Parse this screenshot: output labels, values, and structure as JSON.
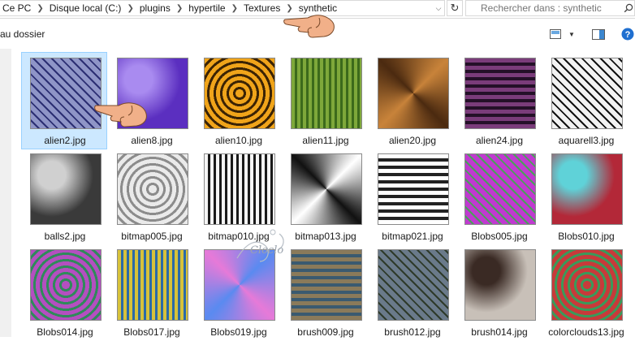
{
  "breadcrumb": {
    "items": [
      "Ce PC",
      "Disque local (C:)",
      "plugins",
      "hypertile",
      "Textures",
      "synthetic"
    ]
  },
  "search": {
    "placeholder": "Rechercher dans : synthetic"
  },
  "toolbar": {
    "up_label": "au dossier"
  },
  "files": [
    {
      "name": "alien2.jpg",
      "selected": true,
      "colors": [
        "#8f95c7",
        "#2c2f73"
      ]
    },
    {
      "name": "alien8.jpg",
      "colors": [
        "#a98bf0",
        "#5b2fc0"
      ]
    },
    {
      "name": "alien10.jpg",
      "colors": [
        "#f0a41a",
        "#3b2304"
      ]
    },
    {
      "name": "alien11.jpg",
      "colors": [
        "#7ea83a",
        "#3c6a1b"
      ]
    },
    {
      "name": "alien20.jpg",
      "colors": [
        "#c8833a",
        "#4b2a10"
      ]
    },
    {
      "name": "alien24.jpg",
      "colors": [
        "#7a3c7a",
        "#241028"
      ]
    },
    {
      "name": "aquarell3.jpg",
      "colors": [
        "#f2f2f2",
        "#111111"
      ]
    },
    {
      "name": "balls2.jpg",
      "colors": [
        "#d0d0d0",
        "#3a3a3a"
      ]
    },
    {
      "name": "bitmap005.jpg",
      "colors": [
        "#eaeaea",
        "#8c8c8c"
      ]
    },
    {
      "name": "bitmap010.jpg",
      "colors": [
        "#f5f5f5",
        "#1a1a1a"
      ]
    },
    {
      "name": "bitmap013.jpg",
      "colors": [
        "#ffffff",
        "#111111"
      ]
    },
    {
      "name": "bitmap021.jpg",
      "colors": [
        "#ffffff",
        "#222222"
      ]
    },
    {
      "name": "Blobs005.jpg",
      "colors": [
        "#c03ad0",
        "#4aa05a"
      ]
    },
    {
      "name": "Blobs010.jpg",
      "colors": [
        "#5fd2d8",
        "#b32838"
      ]
    },
    {
      "name": "Blobs014.jpg",
      "colors": [
        "#b44fc0",
        "#2f8a5a"
      ]
    },
    {
      "name": "Blobs017.jpg",
      "colors": [
        "#d7c23a",
        "#2a6aa8"
      ]
    },
    {
      "name": "Blobs019.jpg",
      "colors": [
        "#5a8af0",
        "#e67ad8"
      ]
    },
    {
      "name": "brush009.jpg",
      "colors": [
        "#8a7a5a",
        "#3a5a70"
      ]
    },
    {
      "name": "brush012.jpg",
      "colors": [
        "#6a7a8a",
        "#2e3a2a"
      ]
    },
    {
      "name": "brush014.jpg",
      "colors": [
        "#3a2a24",
        "#c8c0b8"
      ]
    },
    {
      "name": "colorclouds13.jpg",
      "colors": [
        "#c83a3a",
        "#3a9a5a"
      ]
    }
  ],
  "watermark": {
    "text": "Cloclo"
  }
}
